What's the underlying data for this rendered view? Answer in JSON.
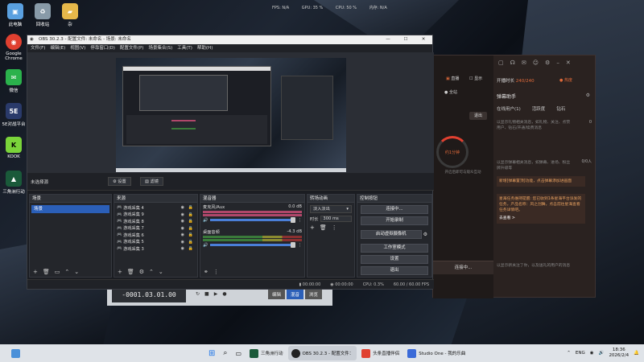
{
  "desktop": {
    "icons": [
      {
        "label": "此电脑",
        "glyph": "▣",
        "color": "#5aa0e0"
      },
      {
        "label": "回收站",
        "glyph": "♻",
        "color": "#9ab"
      },
      {
        "label": "杂",
        "glyph": "▰",
        "color": "#e6b84a"
      },
      {
        "label": "Google Chrome",
        "glyph": "◉",
        "color": "#e04030"
      },
      {
        "label": "微信",
        "glyph": "✉",
        "color": "#2bb24c"
      },
      {
        "label": "5E对战平台",
        "glyph": "5E",
        "color": "#2a3a6a"
      },
      {
        "label": "KOOK",
        "glyph": "K",
        "color": "#7ad43a"
      },
      {
        "label": "三角洲行动",
        "glyph": "▲",
        "color": "#1a5a3a"
      }
    ]
  },
  "perf_overlay": [
    "FPS: N/A",
    "GPU: 35 %",
    "CPU: 50 %",
    "内存: N/A"
  ],
  "obs": {
    "title": "OBS 30.2.3 - 配置文件: 未命名 - 场景: 未命名",
    "menu": [
      "文件(F)",
      "编辑(E)",
      "视图(V)",
      "停靠窗口(D)",
      "配置文件(P)",
      "场景集合(S)",
      "工具(T)",
      "帮助(H)"
    ],
    "source_name": "未选择源",
    "props_label": "⚙ 设置",
    "filter_label": "▤ 滤镜",
    "scenes_title": "场景",
    "scene": "场景",
    "sources_title": "来源",
    "sources": [
      "游戏采集 4",
      "游戏采集 9",
      "游戏采集 8",
      "游戏采集 7",
      "游戏采集 6",
      "游戏采集 5",
      "游戏采集 3"
    ],
    "mixer_title": "混音器",
    "mixer": [
      {
        "name": "麦克风/Aux",
        "db": "0.0 dB"
      },
      {
        "name": "桌面音频",
        "db": "-4.3 dB"
      }
    ],
    "transitions_title": "转场动画",
    "transition": "淡入淡出",
    "duration_label": "时长",
    "duration": "300 ms",
    "controls_title": "控制按钮",
    "controls": [
      "连接中...",
      "开始录制",
      "启动虚拟摄像机",
      "工作室模式",
      "设置",
      "退出"
    ],
    "status": {
      "stream_time": "00:00:00",
      "rec_time": "00:00:00",
      "cpu": "CPU: 0.3%",
      "fps": "60.00 / 60.00 FPS"
    }
  },
  "chat": {
    "tabs": [
      "弹幕助手"
    ],
    "time_label": "开播时长",
    "count": "240/240",
    "mode": "直播",
    "mini": "● 全站",
    "fire": "● 热度",
    "show": "显示",
    "sub_tabs": [
      "在线用户(1)",
      "活跃度",
      "钻石"
    ],
    "gift_hint": "以显示礼物相关消息，如礼物、关注、点赞用户、钻石/开通/续费消息",
    "gift_count": "0",
    "danmaku_hint": "以显示弹幕相关消息，如弹幕、进场、粉丝牌升级等",
    "cap": "0/0人",
    "tip1": "新增[弹幕置顶]功能，点击弹幕添加进画面",
    "tip2": "星海任务维持提醒: 您已收到1条星海平台派发的任务，产品名称：风之创舞，点击前往星海查看任务详情吧。",
    "tip_link": "去查看 >",
    "connect": "连接中...",
    "footer_hint": "以显示新关注了你，以及送礼的用户的消息",
    "exit": "退出",
    "ring": "约1分钟",
    "ring_sub": "开启后即可与观众互动"
  },
  "studio": {
    "timecode": "-0001.03.01.00",
    "tabs": [
      "编辑",
      "混音",
      "浏览"
    ]
  },
  "taskbar": {
    "apps": [
      "三角洲行动",
      "OBS 30.2.3 - 配置文件：",
      "头条直播伴侣",
      "Studio One - 我的乐曲"
    ],
    "lang": "ENG",
    "time": "18:36",
    "date": "2026/2/4"
  },
  "colors": {
    "accent": "#2b5fb8",
    "chat_orange": "#e06a3a",
    "mic_meter": "#b0476a"
  }
}
